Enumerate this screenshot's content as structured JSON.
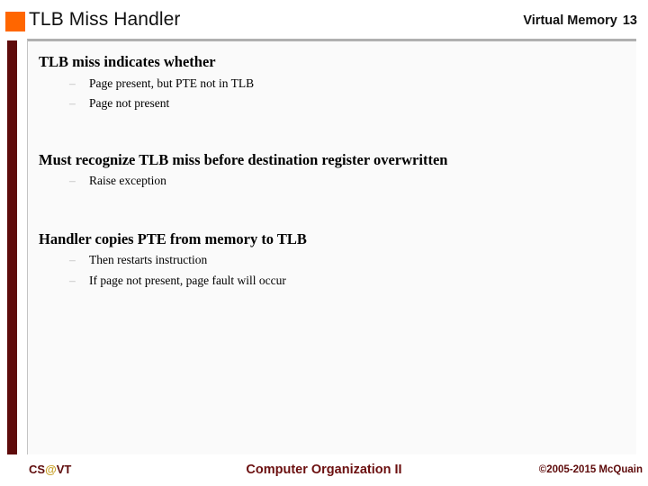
{
  "header": {
    "title": "TLB Miss Handler",
    "right_label": "Virtual Memory",
    "slide_number": "13",
    "accent_color": "#FF6600"
  },
  "theme": {
    "bar_color": "#5E0B0B",
    "panel_bg": "#FAFAFA",
    "panel_border": "#B0B0B0",
    "footer_text_color": "#6B0F0F",
    "at_sign_color": "#C8A02A"
  },
  "body": {
    "groups": [
      {
        "heading": "TLB miss indicates whether",
        "sub_items": [
          "Page present, but PTE not in TLB",
          "Page not present"
        ]
      },
      {
        "heading": "Must recognize TLB miss before destination register overwritten",
        "sub_items": [
          "Raise exception"
        ]
      },
      {
        "heading": "Handler copies PTE from memory to TLB",
        "sub_items": [
          "Then restarts instruction",
          "If page not present, page fault will occur"
        ]
      }
    ],
    "sub_marker": "–"
  },
  "footer": {
    "logo_prefix": "CS",
    "logo_at": "@",
    "logo_suffix": "VT",
    "course": "Computer Organization II",
    "copyright": "©2005-2015 McQuain"
  }
}
